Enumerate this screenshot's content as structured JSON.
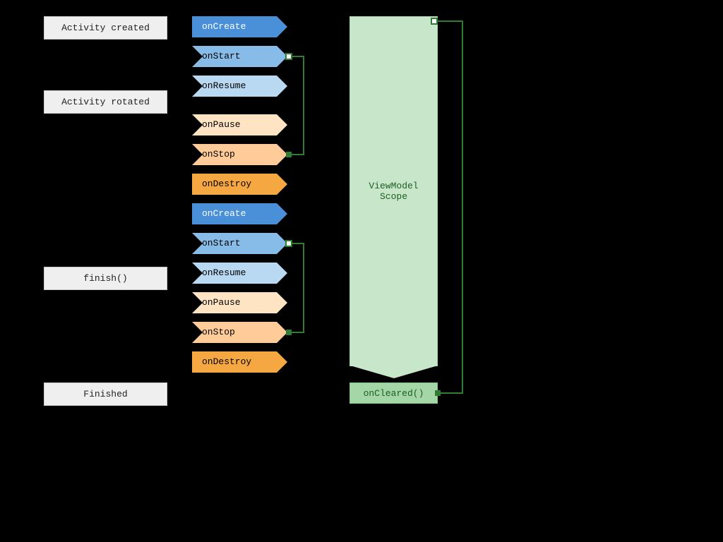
{
  "states": {
    "created": "Activity created",
    "rotated": "Activity rotated",
    "finish_call": "finish()",
    "finished": "Finished"
  },
  "lifecycle": {
    "onCreate": "onCreate",
    "onStart": "onStart",
    "onResume": "onResume",
    "onPause": "onPause",
    "onStop": "onStop",
    "onDestroy": "onDestroy"
  },
  "viewmodel": {
    "scope_label": "ViewModel\nScope",
    "oncleared_label": "onCleared()"
  },
  "colors": {
    "onCreate": "#4a90d9",
    "onStart": "#88bce8",
    "onResume": "#b9d9f2",
    "onPause": "#ffe4c4",
    "onStop": "#ffcc99",
    "onDestroy": "#f5a742",
    "connector": "#2e7d32"
  }
}
